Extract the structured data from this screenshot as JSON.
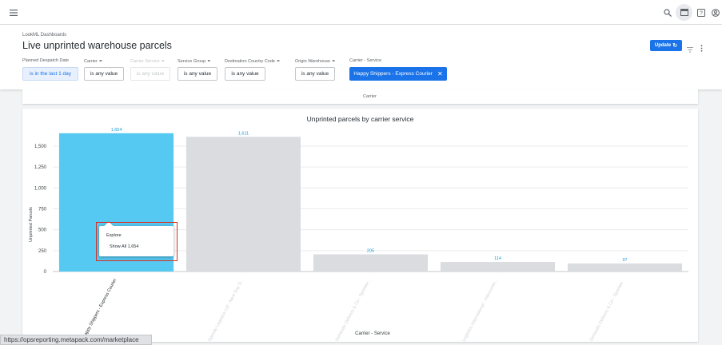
{
  "topbar": {
    "icons": [
      "menu-icon",
      "search-icon",
      "dashboard-icon",
      "help-icon",
      "account-icon"
    ]
  },
  "header": {
    "breadcrumb": "LookML Dashboards",
    "title": "Live unprinted warehouse parcels",
    "update_label": "Update"
  },
  "filters": [
    {
      "label": "Planned Despatch Date",
      "value": "is in the last 1 day",
      "state": "selected"
    },
    {
      "label": "Carrier",
      "value": "is any value",
      "state": "normal"
    },
    {
      "label": "Carrier Service",
      "value": "is any value",
      "state": "disabled"
    },
    {
      "label": "Service Group",
      "value": "is any value",
      "state": "normal"
    },
    {
      "label": "Destination Country Code",
      "value": "is any value",
      "state": "normal"
    },
    {
      "label": "Origin Warehouse",
      "value": "is any value",
      "state": "normal"
    },
    {
      "label": "Carrier - Service",
      "value": "Happy Shippers - Express Courier",
      "state": "active"
    }
  ],
  "prev_card": {
    "xlabel": "Carrier"
  },
  "chart_data": {
    "type": "bar",
    "title": "Unprinted parcels by carrier service",
    "xlabel": "Carrier - Service",
    "ylabel": "Unprinted Parcels",
    "ylim": [
      0,
      1700
    ],
    "yticks": [
      0,
      250,
      500,
      750,
      "1,000",
      "1,250",
      "1,500"
    ],
    "categories": [
      "Happy Shippers - Express Courier",
      "Speedy Logistics Ltd - Next Day D...",
      "Domestic Delivery & Co - Sportwe...",
      "Logistics International - Intercontin...",
      "Domestic Delivery & Co - Sportwe..."
    ],
    "values": [
      1654,
      1611,
      205,
      114,
      97
    ],
    "value_labels": [
      "1,654",
      "1,611",
      "205",
      "114",
      "97"
    ],
    "highlight_index": 0,
    "colors": {
      "highlight": "#56c9f2",
      "muted": "#dadce0",
      "label": "#1a9bd7"
    }
  },
  "tooltip": {
    "title": "Explore",
    "item": "Show All 1,654"
  },
  "status_bar": {
    "url": "https://opsreporting.metapack.com/marketplace"
  }
}
